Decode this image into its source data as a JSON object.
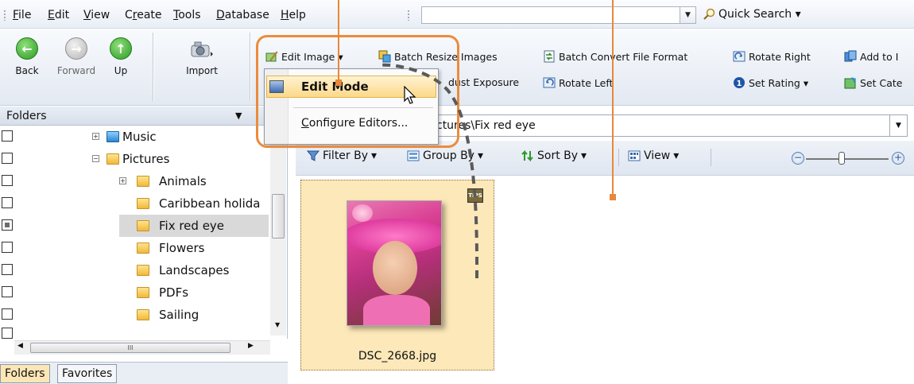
{
  "menubar": {
    "items": [
      {
        "pre": "",
        "u": "F",
        "post": "ile"
      },
      {
        "pre": "",
        "u": "E",
        "post": "dit"
      },
      {
        "pre": "",
        "u": "V",
        "post": "iew"
      },
      {
        "pre": "C",
        "u": "r",
        "post": "eate"
      },
      {
        "pre": "",
        "u": "T",
        "post": "ools"
      },
      {
        "pre": "",
        "u": "D",
        "post": "atabase"
      },
      {
        "pre": "",
        "u": "H",
        "post": "elp"
      }
    ],
    "search_value": "",
    "quick_search_label": "Quick Search",
    "quick_search_arrow": "▾",
    "combo_arrow": "▼"
  },
  "toolbar": {
    "nav": {
      "back": "Back",
      "forward": "Forward",
      "up": "Up",
      "import": "Import"
    },
    "edit_image": "Edit Image",
    "batch_resize": "Batch Resize Images",
    "batch_convert": "Batch Convert File Format",
    "rotate_right": "Rotate Right",
    "add_to": "Add to I",
    "adjust_exposure": "dust Exposure",
    "rotate_left": "Rotate Left",
    "set_rating": "Set Rating",
    "set_category": "Set Cate",
    "dropdown_arrow": "▾"
  },
  "edit_menu": {
    "edit_mode": "Edit Mode",
    "configure_u": "C",
    "configure_rest": "onfigure Editors..."
  },
  "panel": {
    "title": "Folders",
    "title_arrow": "▼",
    "tree": [
      {
        "label": "Music",
        "indent": 2
      },
      {
        "label": "Pictures",
        "indent": 2
      },
      {
        "label": "Animals",
        "indent": 3
      },
      {
        "label": "Caribbean holida",
        "indent": 3
      },
      {
        "label": "Fix red eye",
        "indent": 3
      },
      {
        "label": "Flowers",
        "indent": 3
      },
      {
        "label": "Landscapes",
        "indent": 3
      },
      {
        "label": "PDFs",
        "indent": 3
      },
      {
        "label": "Sailing",
        "indent": 3
      }
    ],
    "hscroll_grip": "III",
    "tabs": {
      "folders": "Folders",
      "favorites": "Favorites"
    }
  },
  "address": {
    "value": "ctures\\Fix red eye",
    "arrow": "▼"
  },
  "filterbar": {
    "filter_by": "Filter By",
    "group_by": "Group By",
    "sort_by": "Sort By",
    "view": "View",
    "zoom_minus": "−",
    "zoom_plus": "+",
    "arrow": "▾"
  },
  "thumbnail": {
    "filename": "DSC_2668.jpg",
    "badge": "TIPS"
  },
  "colors": {
    "accent": "#ec8b3c",
    "selection": "#fde8b9"
  }
}
